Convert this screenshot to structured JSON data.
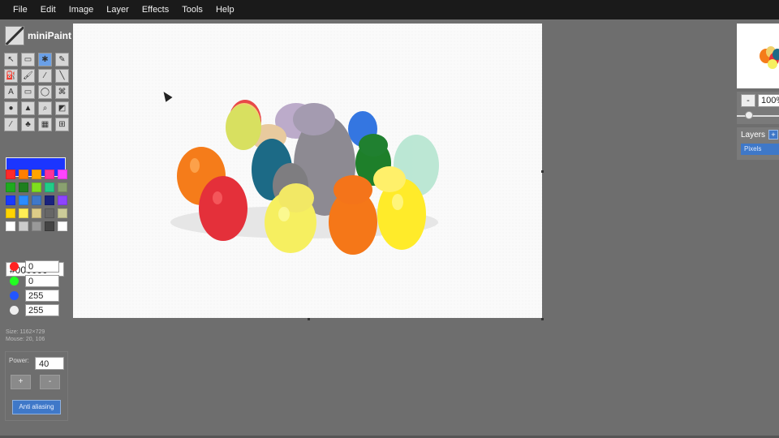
{
  "menu": {
    "items": [
      "File",
      "Edit",
      "Image",
      "Layer",
      "Effects",
      "Tools",
      "Help"
    ]
  },
  "app": {
    "name": "miniPaint"
  },
  "tools": [
    {
      "icon": "select-arrow-icon",
      "glyph": "↖",
      "active": false
    },
    {
      "icon": "select-rect-icon",
      "glyph": "▭",
      "active": false
    },
    {
      "icon": "magic-wand-icon",
      "glyph": "✱",
      "active": true
    },
    {
      "icon": "pencil-icon",
      "glyph": "✎",
      "active": false
    },
    {
      "icon": "fill-bucket-icon",
      "glyph": "⛽",
      "active": false
    },
    {
      "icon": "brush-icon",
      "glyph": "🖌",
      "active": false
    },
    {
      "icon": "pick-color-icon",
      "glyph": "⁄",
      "active": false
    },
    {
      "icon": "line-icon",
      "glyph": "╲",
      "active": false
    },
    {
      "icon": "text-icon",
      "glyph": "A",
      "active": false
    },
    {
      "icon": "rectangle-icon",
      "glyph": "▭",
      "active": false
    },
    {
      "icon": "ellipse-icon",
      "glyph": "◯",
      "active": false
    },
    {
      "icon": "spray-icon",
      "glyph": "⌘",
      "active": false
    },
    {
      "icon": "blur-drop-icon",
      "glyph": "●",
      "active": false
    },
    {
      "icon": "sharpen-icon",
      "glyph": "▲",
      "active": false
    },
    {
      "icon": "zoom-icon",
      "glyph": "⌕",
      "active": false
    },
    {
      "icon": "erase-icon",
      "glyph": "◩",
      "active": false
    },
    {
      "icon": "pipette-icon",
      "glyph": "⁄",
      "active": false
    },
    {
      "icon": "clone-icon",
      "glyph": "♣",
      "active": false
    },
    {
      "icon": "gradient-icon",
      "glyph": "▦",
      "active": false
    },
    {
      "icon": "crop-icon",
      "glyph": "⊞",
      "active": false
    }
  ],
  "colors": {
    "main": "#1b35ff",
    "palette": [
      "#ff2a2a",
      "#ff7f00",
      "#ffa500",
      "#ff3399",
      "#ff44ff",
      "#1faa1f",
      "#1f7f1f",
      "#7fdf1f",
      "#22cc88",
      "#8aa070",
      "#1a3aff",
      "#2a8cff",
      "#3f78c8",
      "#1a237e",
      "#8e44ff",
      "#ffd400",
      "#ffee55",
      "#ddcc88",
      "#666666",
      "#cccc99",
      "#ffffff",
      "#cccccc",
      "#999999",
      "#444444",
      "#ffffff"
    ],
    "hex": "#000000",
    "channels": [
      {
        "icon": "red-dot-icon",
        "color": "#ff2222",
        "value": "0"
      },
      {
        "icon": "green-dot-icon",
        "color": "#22ff22",
        "value": "0"
      },
      {
        "icon": "blue-dot-icon",
        "color": "#2255ff",
        "value": "255"
      },
      {
        "icon": "alpha-dot-icon",
        "color": "#eeeeee",
        "value": "255"
      }
    ]
  },
  "info": {
    "line1": "Size: 1162×729",
    "line2": "Mouse: 20, 106"
  },
  "attributes": {
    "power_label": "Power:",
    "power_value": "40",
    "plus_label": "+",
    "minus_label": "-",
    "antialias_label": "Anti aliasing"
  },
  "navigator": {
    "zoom_minus": "-",
    "zoom_value": "100%"
  },
  "layers": {
    "title": "Layers",
    "add_label": "+",
    "items": [
      "Pixels"
    ]
  }
}
